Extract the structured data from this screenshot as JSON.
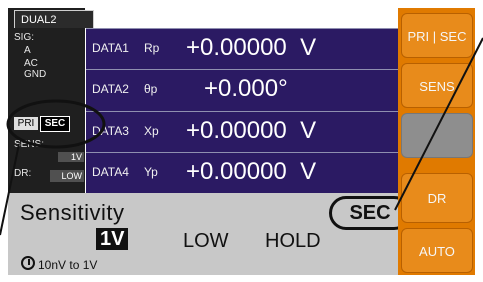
{
  "left_panel": {
    "tab_label": "DUAL2",
    "sig_label": "SIG:",
    "sig_a": "A",
    "sig_ac": "AC",
    "sig_gnd": "GND",
    "pri_tag": "PRI",
    "sec_tag": "SEC",
    "sens_label": "SENS:",
    "sens_value": "1V",
    "dr_label": "DR:",
    "dr_value": "LOW"
  },
  "rows": [
    {
      "name": "DATA1",
      "symbol": "Rp",
      "value": "+0.00000  V"
    },
    {
      "name": "DATA2",
      "symbol": "θp",
      "value": "+0.000°"
    },
    {
      "name": "DATA3",
      "symbol": "Xp",
      "value": "+0.00000  V"
    },
    {
      "name": "DATA4",
      "symbol": "Yp",
      "value": "+0.00000  V"
    }
  ],
  "bottom": {
    "title": "Sensitivity",
    "option_1v": "1V",
    "option_low": "LOW",
    "option_hold": "HOLD",
    "range": "10nV to 1V",
    "sec_badge": "SEC"
  },
  "softkeys": {
    "pri_sec": "PRI | SEC",
    "sens": "SENS",
    "blank": "",
    "dr": "DR",
    "auto": "AUTO"
  },
  "colors": {
    "rows_bg": "#2b1a63",
    "softkey_orange": "#e88b1b",
    "panel_grey": "#c8c8c8"
  },
  "icons": {
    "range_knob": "rotary-knob-icon"
  }
}
